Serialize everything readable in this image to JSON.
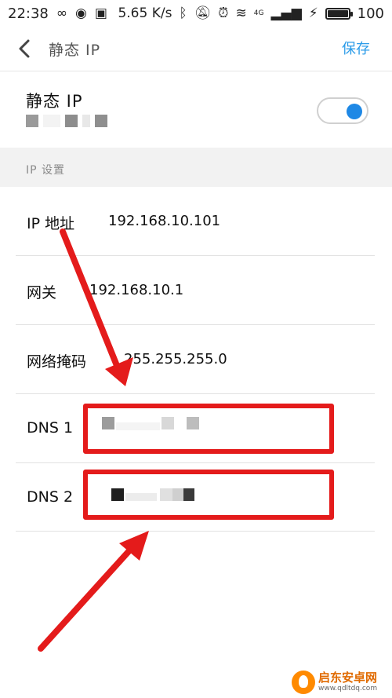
{
  "status_bar": {
    "time": "22:38",
    "speed": "5.65 K/s",
    "network": "4G",
    "battery": "100",
    "battery_level": 1.0
  },
  "header": {
    "title": "静态 IP",
    "save_label": "保存"
  },
  "static_ip": {
    "label": "静态 IP",
    "enabled": true
  },
  "section": {
    "label": "IP 设置"
  },
  "rows": {
    "ip": {
      "label": "IP 地址",
      "value": "192.168.10.101"
    },
    "gateway": {
      "label": "网关",
      "value": "192.168.10.1"
    },
    "netmask": {
      "label": "网络掩码",
      "value": "255.255.255.0"
    },
    "dns1": {
      "label": "DNS 1"
    },
    "dns2": {
      "label": "DNS 2"
    }
  },
  "colors": {
    "accent": "#2a9be8",
    "toggle_on": "#1e88e5",
    "highlight": "#e41b1b"
  },
  "watermark": {
    "name": "启东安卓网",
    "url": "www.qdltdq.com"
  }
}
